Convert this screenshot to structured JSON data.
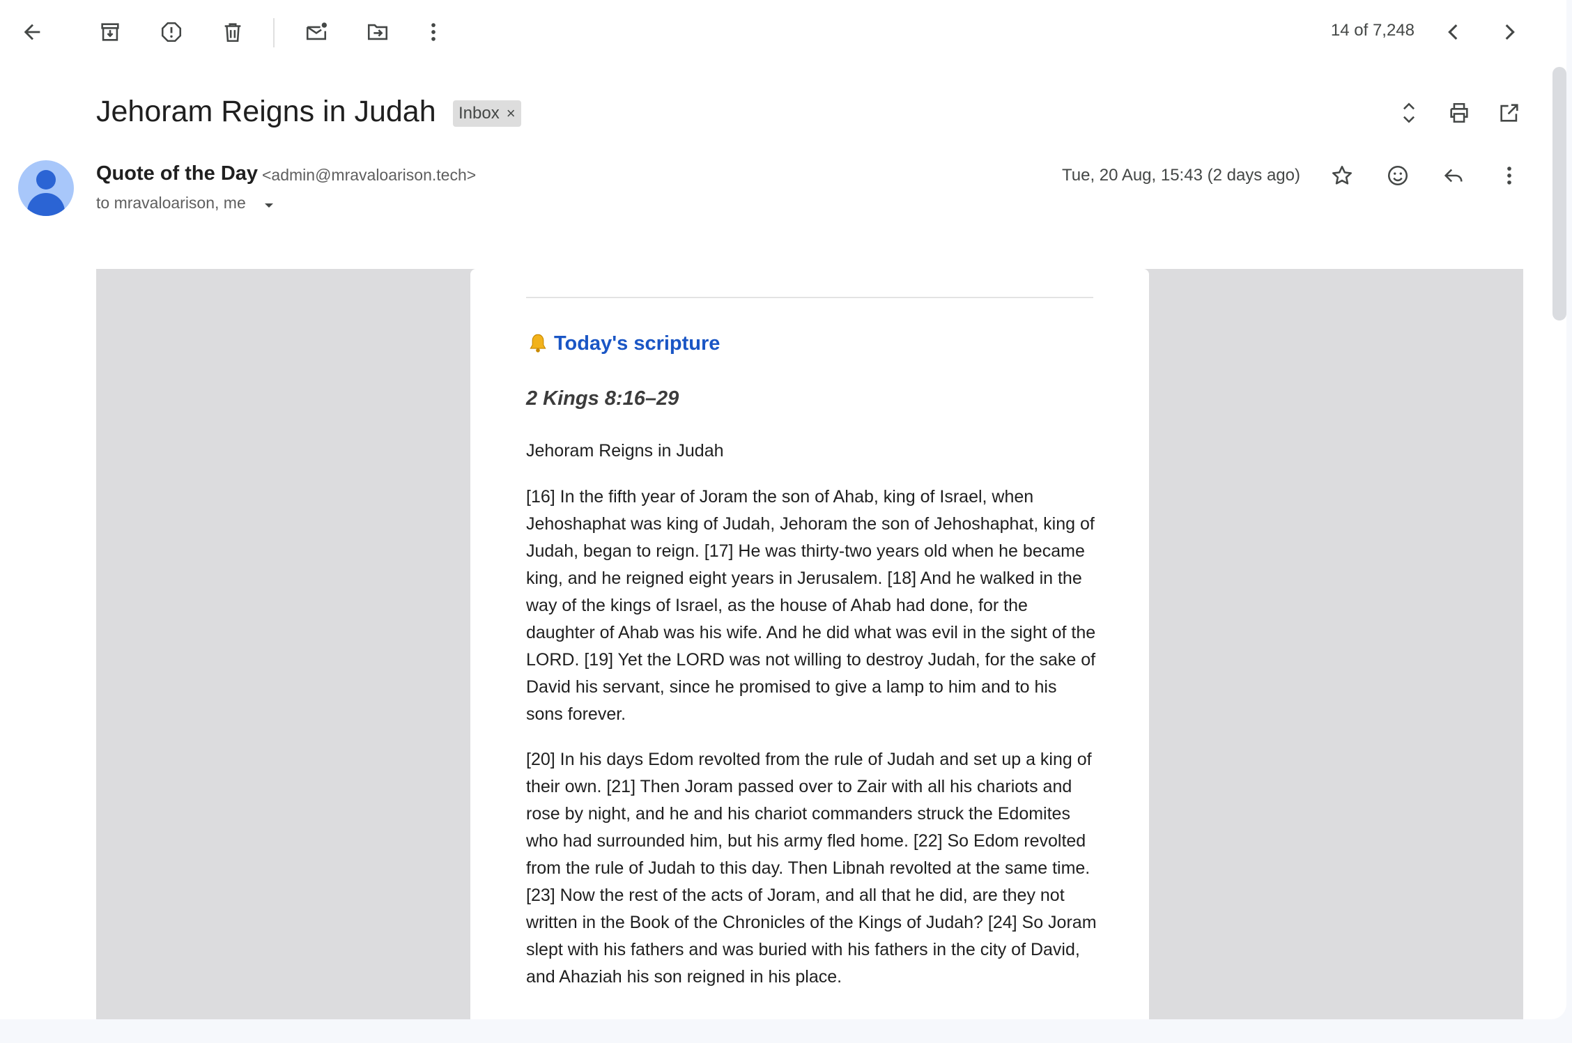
{
  "toolbar": {
    "counter": "14 of 7,248"
  },
  "email": {
    "subject": "Jehoram Reigns in Judah",
    "label": "Inbox",
    "label_remove": "×",
    "sender_name": "Quote of the Day",
    "sender_email": "<admin@mravaloarison.tech>",
    "recipients": "to mravaloarison, me",
    "date": "Tue, 20 Aug, 15:43 (2 days ago)"
  },
  "content": {
    "section_heading": "Today's scripture",
    "reference": "2 Kings 8:16–29",
    "passage_title": "Jehoram Reigns in Judah",
    "paragraphs": [
      "[16] In the fifth year of Joram the son of Ahab, king of Israel, when Jehoshaphat was king of Judah, Jehoram the son of Jehoshaphat, king of Judah, began to reign. [17] He was thirty-two years old when he became king, and he reigned eight years in Jerusalem. [18] And he walked in the way of the kings of Israel, as the house of Ahab had done, for the daughter of Ahab was his wife. And he did what was evil in the sight of the LORD. [19] Yet the LORD was not willing to destroy Judah, for the sake of David his servant, since he promised to give a lamp to him and to his sons forever.",
      "[20] In his days Edom revolted from the rule of Judah and set up a king of their own. [21] Then Joram passed over to Zair with all his chariots and rose by night, and he and his chariot commanders struck the Edomites who had surrounded him, but his army fled home. [22] So Edom revolted from the rule of Judah to this day. Then Libnah revolted at the same time. [23] Now the rest of the acts of Joram, and all that he did, are they not written in the Book of the Chronicles of the Kings of Judah? [24] So Joram slept with his fathers and was buried with his fathers in the city of David, and Ahaziah his son reigned in his place."
    ]
  },
  "colors": {
    "accent_link": "#1a56c5",
    "avatar_bg": "#a8c7fa",
    "avatar_fg": "#2b64d4",
    "email_outer_bg": "#dcdcde"
  },
  "icons": [
    "back-icon",
    "archive-icon",
    "report-spam-icon",
    "delete-icon",
    "mark-unread-icon",
    "move-to-icon",
    "more-vert-icon",
    "chevron-left-icon",
    "chevron-right-icon",
    "expand-all-icon",
    "print-icon",
    "open-in-new-icon",
    "star-icon",
    "emoji-icon",
    "reply-icon",
    "bell-icon",
    "caret-down-icon"
  ]
}
